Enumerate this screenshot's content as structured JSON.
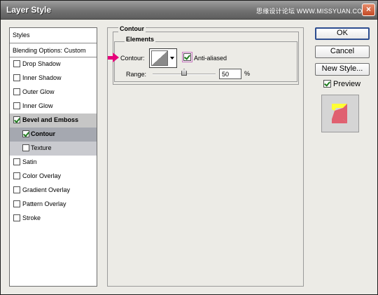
{
  "window": {
    "title": "Layer Style",
    "watermark": "思缘设计论坛 WWW.MISSYUAN.COM",
    "close_glyph": "×"
  },
  "styles_panel": {
    "header": "Styles",
    "blending_options": "Blending Options: Custom",
    "items": [
      {
        "label": "Drop Shadow",
        "checked": false
      },
      {
        "label": "Inner Shadow",
        "checked": false
      },
      {
        "label": "Outer Glow",
        "checked": false
      },
      {
        "label": "Inner Glow",
        "checked": false
      },
      {
        "label": "Bevel and Emboss",
        "checked": true
      },
      {
        "label": "Contour",
        "checked": true
      },
      {
        "label": "Texture",
        "checked": false
      },
      {
        "label": "Satin",
        "checked": false
      },
      {
        "label": "Color Overlay",
        "checked": false
      },
      {
        "label": "Gradient Overlay",
        "checked": false
      },
      {
        "label": "Pattern Overlay",
        "checked": false
      },
      {
        "label": "Stroke",
        "checked": false
      }
    ]
  },
  "contour_panel": {
    "group_title": "Contour",
    "elements_title": "Elements",
    "contour_label": "Contour:",
    "anti_aliased_label": "Anti-aliased",
    "anti_aliased_checked": true,
    "range_label": "Range:",
    "range_value": "50",
    "range_unit": "%",
    "range_fraction": 0.5
  },
  "buttons": {
    "ok": "OK",
    "cancel": "Cancel",
    "new_style": "New Style...",
    "preview_label": "Preview",
    "preview_checked": true
  },
  "colors": {
    "pointer_arrow": "#e6007a",
    "check_mark": "#1d7a1d",
    "preview_yellow": "#ffff33",
    "preview_red": "#e06070"
  }
}
